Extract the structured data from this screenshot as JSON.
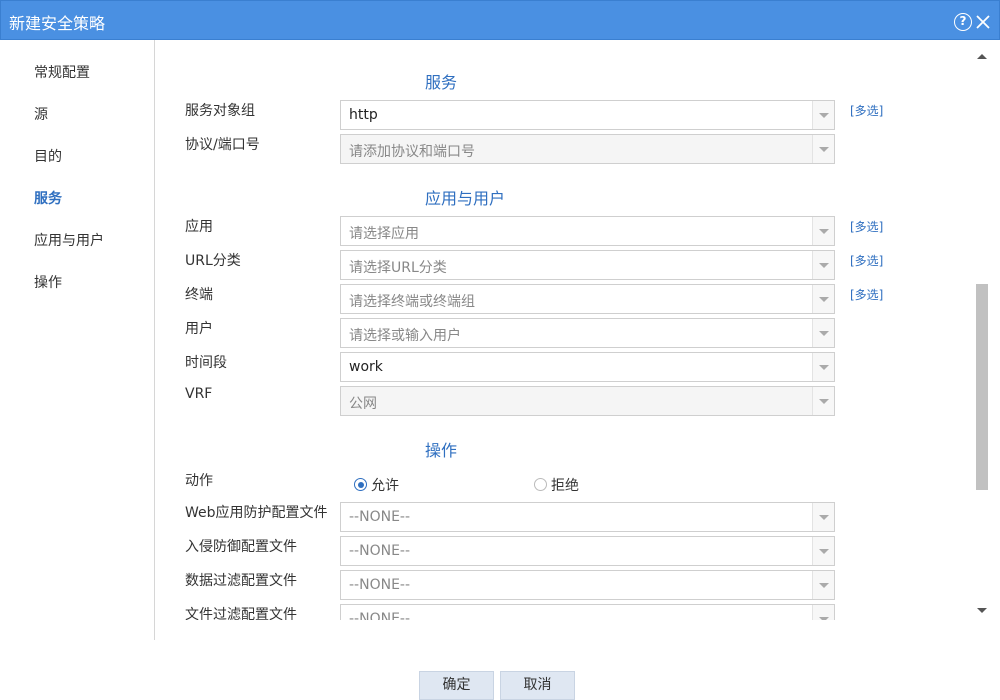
{
  "window": {
    "title": "新建安全策略"
  },
  "sidebar": {
    "items": [
      {
        "label": "常规配置"
      },
      {
        "label": "源"
      },
      {
        "label": "目的"
      },
      {
        "label": "服务"
      },
      {
        "label": "应用与用户"
      },
      {
        "label": "操作"
      }
    ],
    "active": "服务"
  },
  "service": {
    "title": "服务",
    "object_group": {
      "label": "服务对象组",
      "value": "http",
      "multi": "[多选]"
    },
    "protocol_port": {
      "label": "协议/端口号",
      "placeholder": "请添加协议和端口号"
    }
  },
  "app_user": {
    "title": "应用与用户",
    "application": {
      "label": "应用",
      "placeholder": "请选择应用",
      "multi": "[多选]"
    },
    "url_category": {
      "label": "URL分类",
      "placeholder": "请选择URL分类",
      "multi": "[多选]"
    },
    "terminal": {
      "label": "终端",
      "placeholder": "请选择终端或终端组",
      "multi": "[多选]"
    },
    "user": {
      "label": "用户",
      "placeholder": "请选择或输入用户"
    },
    "time_range": {
      "label": "时间段",
      "value": "work"
    },
    "vrf": {
      "label": "VRF",
      "value": "公网"
    }
  },
  "action": {
    "title": "操作",
    "action": {
      "label": "动作",
      "allow": "允许",
      "deny": "拒绝",
      "selected": "允许"
    },
    "waf_profile": {
      "label": "Web应用防护配置文件",
      "value": "--NONE--"
    },
    "ips_profile": {
      "label": "入侵防御配置文件",
      "value": "--NONE--"
    },
    "data_filter_profile": {
      "label": "数据过滤配置文件",
      "value": "--NONE--"
    },
    "file_filter_profile": {
      "label": "文件过滤配置文件",
      "value": "--NONE--"
    }
  },
  "footer": {
    "ok": "确定",
    "cancel": "取消"
  },
  "colors": {
    "titlebar": "#4a90e2",
    "accent": "#2f6fc0"
  }
}
